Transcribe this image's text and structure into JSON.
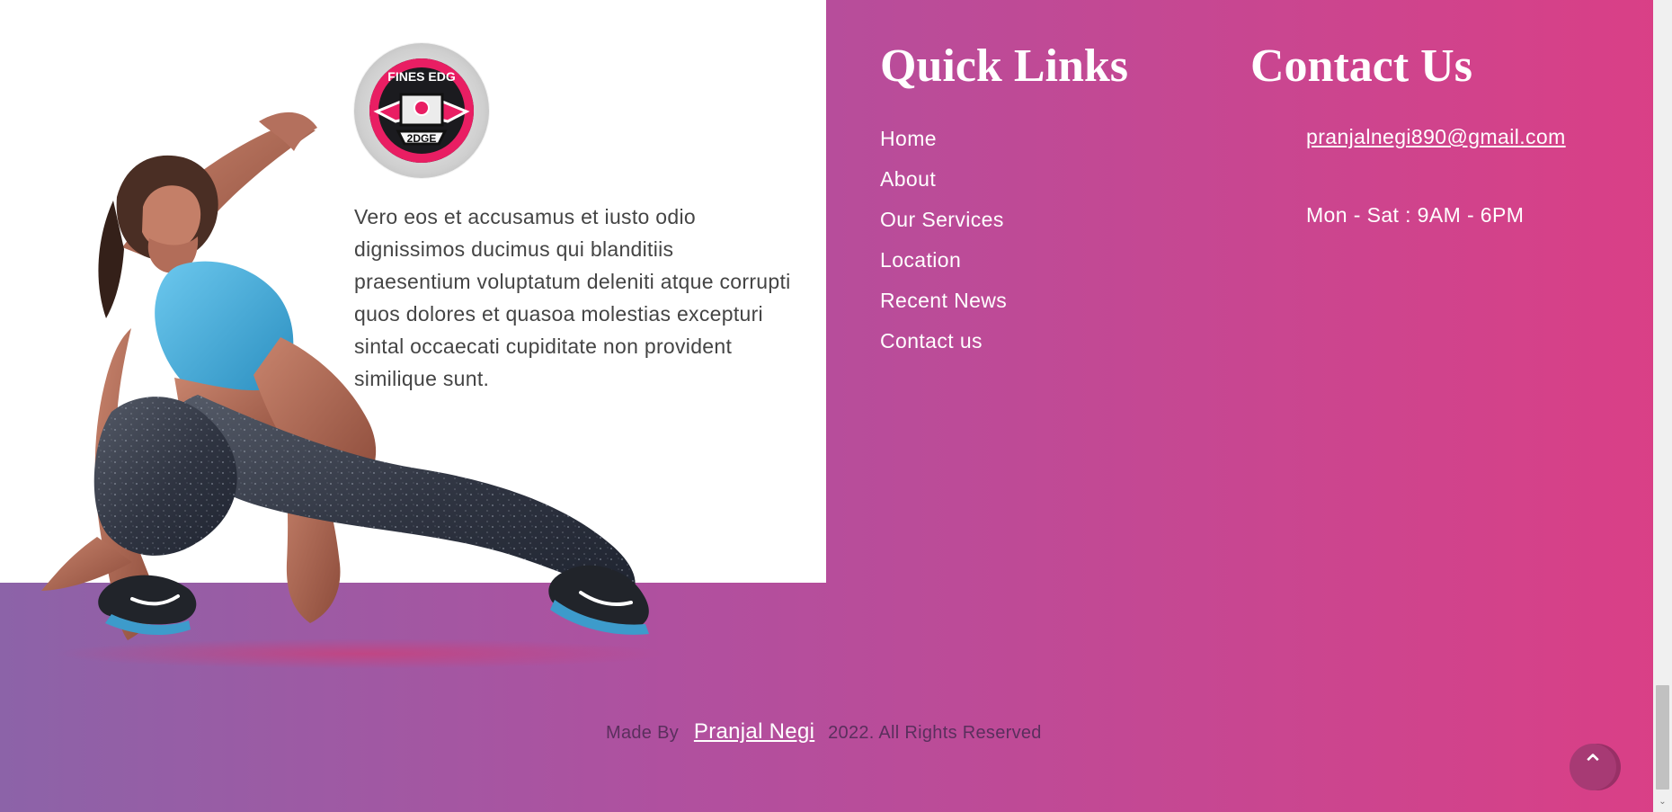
{
  "brand": {
    "logo_top_text": "FINES EDG",
    "logo_bottom_text": "2DGE"
  },
  "about": {
    "text": "Vero eos et accusamus et iusto odio dignissimos ducimus qui blanditiis praesentium voluptatum deleniti atque corrupti quos dolores et quasoa molestias excepturi sintal occaecati cupiditate non provident similique sunt."
  },
  "quick_links": {
    "title": "Quick Links",
    "items": [
      {
        "label": "Home"
      },
      {
        "label": "About"
      },
      {
        "label": "Our Services"
      },
      {
        "label": "Location"
      },
      {
        "label": "Recent News"
      },
      {
        "label": "Contact us"
      }
    ]
  },
  "contact": {
    "title": "Contact Us",
    "email": "pranjalnegi890@gmail.com",
    "hours": "Mon - Sat : 9AM - 6PM"
  },
  "footer": {
    "made_by": "Made By",
    "author": "Pranjal Negi",
    "rights": "2022. All Rights Reserved"
  },
  "icons": {
    "back_to_top": "chevron-up-icon",
    "scroll_down": "scroll-down-arrow-icon"
  },
  "colors": {
    "gradient_start": "#8c63a8",
    "gradient_mid": "#b0509f",
    "gradient_end": "#da3f86",
    "accent_pink": "#e91e63"
  }
}
